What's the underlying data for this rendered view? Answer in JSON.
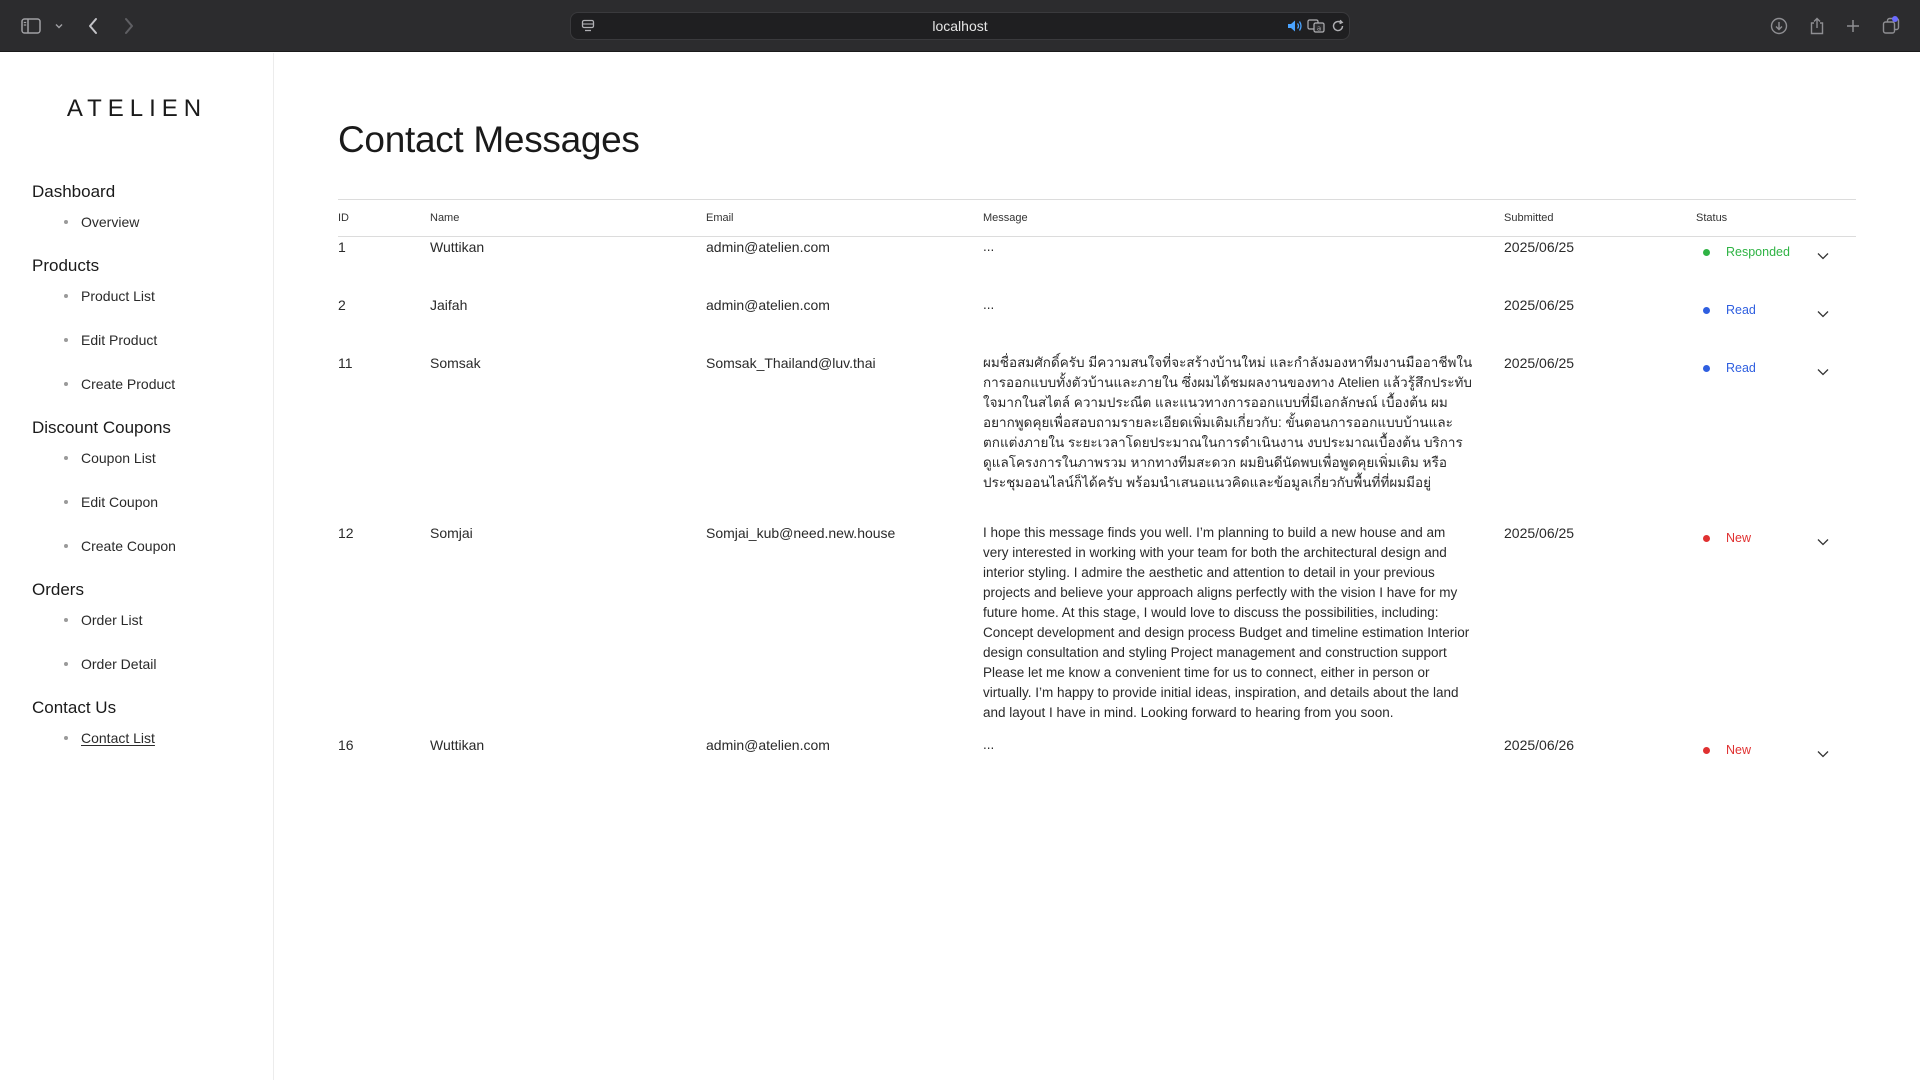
{
  "browser": {
    "url": "localhost"
  },
  "brand": {
    "logo": "ATELIEN"
  },
  "sidebar": {
    "sections": [
      {
        "heading": "Dashboard",
        "items": [
          "Overview"
        ]
      },
      {
        "heading": "Products",
        "items": [
          "Product List",
          "Edit Product",
          "Create Product"
        ]
      },
      {
        "heading": "Discount Coupons",
        "items": [
          "Coupon List",
          "Edit Coupon",
          "Create Coupon"
        ]
      },
      {
        "heading": "Orders",
        "items": [
          "Order List",
          "Order Detail"
        ]
      },
      {
        "heading": "Contact Us",
        "items": [
          "Contact List"
        ]
      }
    ],
    "active_item": "Contact List"
  },
  "page": {
    "title": "Contact Messages"
  },
  "table": {
    "columns": {
      "id": "ID",
      "name": "Name",
      "email": "Email",
      "message": "Message",
      "submitted": "Submitted",
      "status": "Status"
    },
    "rows": [
      {
        "id": "1",
        "name": "Wuttikan",
        "email": "admin@atelien.com",
        "message": "...",
        "submitted": "2025/06/25",
        "status": "Responded",
        "status_color": "#2fb344"
      },
      {
        "id": "2",
        "name": "Jaifah",
        "email": "admin@atelien.com",
        "message": "...",
        "submitted": "2025/06/25",
        "status": "Read",
        "status_color": "#2f5fe0"
      },
      {
        "id": "11",
        "name": "Somsak",
        "email": "Somsak_Thailand@luv.thai",
        "message": "ผมชื่อสมศักดิ์ครับ มีความสนใจที่จะสร้างบ้านใหม่ และกำลังมองหาทีมงานมืออาชีพในการออกแบบทั้งตัวบ้านและภายใน ซึ่งผมได้ชมผลงานของทาง Atelien แล้วรู้สึกประทับใจมากในสไตล์ ความประณีต และแนวทางการออกแบบที่มีเอกลักษณ์ เบื้องต้น ผมอยากพูดคุยเพื่อสอบถามรายละเอียดเพิ่มเติมเกี่ยวกับ: ขั้นตอนการออกแบบบ้านและตกแต่งภายใน ระยะเวลาโดยประมาณในการดำเนินงาน งบประมาณเบื้องต้น บริการดูแลโครงการในภาพรวม หากทางทีมสะดวก ผมยินดีนัดพบเพื่อพูดคุยเพิ่มเติม หรือประชุมออนไลน์ก็ได้ครับ พร้อมนำเสนอแนวคิดและข้อมูลเกี่ยวกับพื้นที่ที่ผมมีอยู่",
        "submitted": "2025/06/25",
        "status": "Read",
        "status_color": "#2f5fe0"
      },
      {
        "id": "12",
        "name": "Somjai",
        "email": "Somjai_kub@need.new.house",
        "message": "I hope this message finds you well. I’m planning to build a new house and am very interested in working with your team for both the architectural design and interior styling. I admire the aesthetic and attention to detail in your previous projects and believe your approach aligns perfectly with the vision I have for my future home. At this stage, I would love to discuss the possibilities, including: Concept development and design process Budget and timeline estimation Interior design consultation and styling Project management and construction support Please let me know a convenient time for us to connect, either in person or virtually. I’m happy to provide initial ideas, inspiration, and details about the land and layout I have in mind. Looking forward to hearing from you soon.",
        "submitted": "2025/06/25",
        "status": "New",
        "status_color": "#e03131"
      },
      {
        "id": "16",
        "name": "Wuttikan",
        "email": "admin@atelien.com",
        "message": "...",
        "submitted": "2025/06/26",
        "status": "New",
        "status_color": "#e03131"
      }
    ]
  },
  "icons": {
    "sidebar_toggle": "sidebar-icon",
    "back": "chevron-left-icon",
    "forward": "chevron-right-icon",
    "download": "download-icon",
    "share": "share-icon",
    "new_tab": "plus-icon",
    "tabs": "tabs-overview-icon",
    "status_toggle": "chevron-down-icon"
  }
}
